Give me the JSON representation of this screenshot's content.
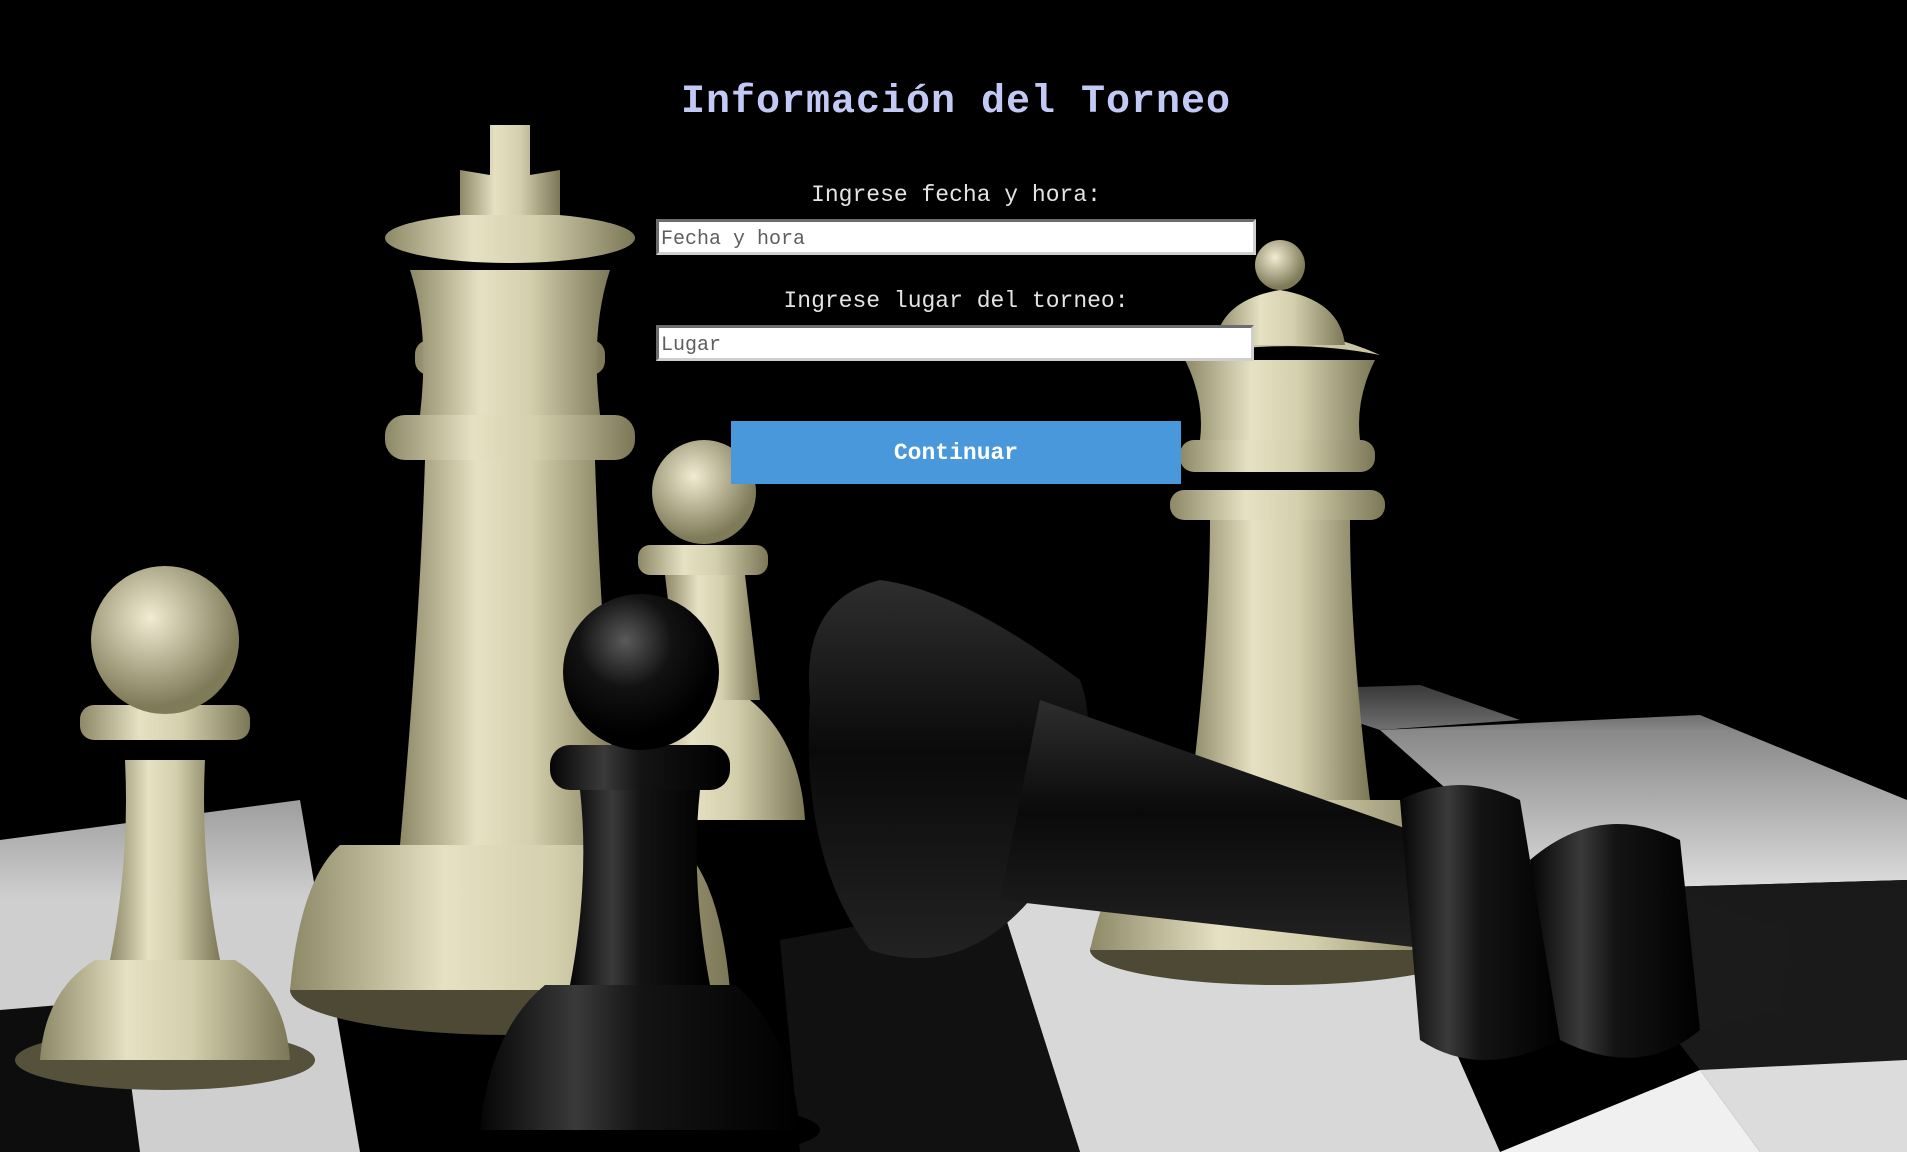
{
  "form": {
    "title": "Información del Torneo",
    "date_label": "Ingrese fecha y hora:",
    "date_value": "",
    "date_placeholder": "Fecha y hora",
    "place_label": "Ingrese lugar del torneo:",
    "place_value": "",
    "place_placeholder": "Lugar",
    "continue_label": "Continuar"
  },
  "background": {
    "image": "chess-pieces-on-checkered-board"
  },
  "colors": {
    "page_background": "#000000",
    "title": "#c3c9f5",
    "label": "#e4e4e4",
    "button_background": "#4a98dc",
    "button_text": "#ffffff",
    "ivory_piece": "#d9d4b2",
    "black_piece": "#111111"
  }
}
